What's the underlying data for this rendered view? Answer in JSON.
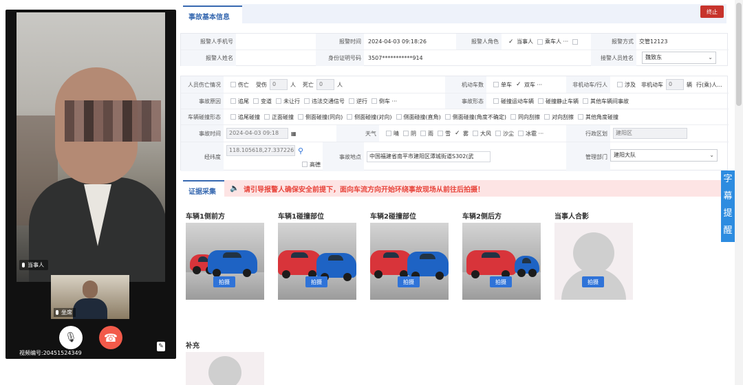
{
  "video": {
    "party_tag": "当事人",
    "agent_tag": "坐席",
    "video_no_label": "视频编号",
    "video_no": "20451524349",
    "icons": {
      "mic": "microphone-icon",
      "hangup": "hangup-icon",
      "note": "notes-icon"
    },
    "colors": {
      "hangup": "#f25a4a"
    }
  },
  "basic": {
    "tab_label": "事故基本信息",
    "stop_button": "终止",
    "phone_label": "报警人手机号",
    "phone_value": "",
    "report_time_label": "报警时间",
    "report_time_value": "2024-04-03 09:18:26",
    "role_label": "报警人角色",
    "role_options": [
      {
        "label": "当事人",
        "checked": true
      },
      {
        "label": "乘车人 ···",
        "checked": false
      }
    ],
    "method_label": "报警方式",
    "method_value": "交管12123",
    "name_label": "报警人姓名",
    "name_value": "",
    "id_label": "身份证明号码",
    "id_value": "3507***********914",
    "receiver_label": "接警人员姓名",
    "receiver_value": "魏致东"
  },
  "casualty": {
    "label": "人员伤亡情况",
    "injured_check": "伤亡",
    "injured_label": "受伤",
    "injured_value": "0",
    "person_unit": "人",
    "dead_label": "死亡",
    "dead_value": "0",
    "person_unit2": "人",
    "motor_count_label": "机动车数",
    "motor_options": [
      {
        "label": "单车",
        "checked": false
      },
      {
        "label": "双车 ···",
        "checked": true
      }
    ],
    "nonmotor_label": "非机动车/行人",
    "involve_check": "涉及",
    "nonmotor_count_label": "非机动车",
    "nonmotor_value": "0",
    "vehicle_unit": "辆",
    "pedestrian_label": "行(乘)人..."
  },
  "cause": {
    "label": "事故原因",
    "options": [
      "追尾",
      "变道",
      "未让行",
      "违法交通信号",
      "逆行",
      "倒车 ···"
    ],
    "form_label": "事故形态",
    "form_options": [
      "碰撞运动车辆",
      "碰撞静止车辆",
      "其他车辆间事故"
    ]
  },
  "collision": {
    "label": "车辆碰撞形态",
    "options": [
      "追尾碰撞",
      "正面碰撞",
      "侧面碰撞(同向)",
      "侧面碰撞(对向)",
      "侧面碰撞(直角)",
      "侧面碰撞(角度不确定)",
      "同向刮擦",
      "对向刮擦",
      "其他角度碰撞"
    ]
  },
  "timeweather": {
    "time_label": "事故时间",
    "time_value": "2024-04-03 09:18",
    "weather_label": "天气",
    "weather_options": [
      {
        "label": "晴",
        "checked": false
      },
      {
        "label": "阴",
        "checked": false
      },
      {
        "label": "雨",
        "checked": false
      },
      {
        "label": "雪",
        "checked": false
      },
      {
        "label": "雾",
        "checked": true
      },
      {
        "label": "大风",
        "checked": false
      },
      {
        "label": "沙尘",
        "checked": false
      },
      {
        "label": "冰雹 ···",
        "checked": false
      }
    ],
    "district_label": "行政区划",
    "district_value": "建阳区"
  },
  "location": {
    "coords_label": "经纬度",
    "coords_value": "118.105618,27.337226",
    "hd_label": "高德",
    "place_label": "事故地点",
    "place_value": "中国福建省南平市建阳区潭城街道S302(武",
    "dept_label": "管理部门",
    "dept_value": "建阳大队"
  },
  "evidence": {
    "tab_label": "证据采集",
    "notice": "请引导报警人确保安全前提下，面向车流方向开始环绕事故现场从前往后拍摄！",
    "shoot_label": "拍摄",
    "photos": [
      {
        "title": "车辆1侧前方"
      },
      {
        "title": "车辆1碰撞部位"
      },
      {
        "title": "车辆2碰撞部位"
      },
      {
        "title": "车辆2侧后方"
      },
      {
        "title": "当事人合影"
      }
    ],
    "supplement_label": "补充",
    "colors": {
      "accent": "#2f73d8",
      "notice_bg": "#fde4e4",
      "notice_text": "#e8453c"
    }
  },
  "subtitle_reminder": "字幕提醒"
}
